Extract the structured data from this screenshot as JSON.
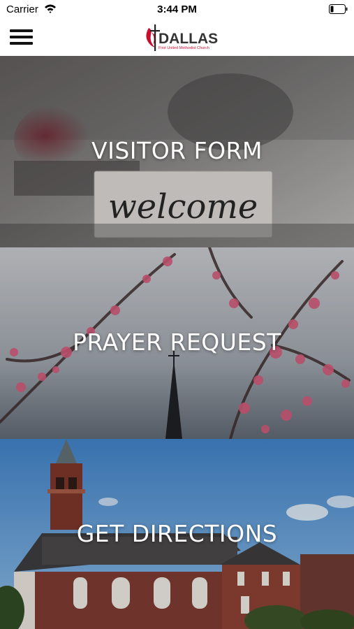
{
  "status_bar": {
    "carrier": "Carrier",
    "time": "3:44 PM",
    "wifi_icon": "wifi-icon",
    "battery_icon": "battery-icon"
  },
  "header": {
    "menu_icon": "hamburger-menu-icon",
    "logo": {
      "wordmark": "DALLAS",
      "subtitle": "First United Methodist Church",
      "colors": {
        "flame": "#c8102e",
        "cross": "#222222"
      }
    }
  },
  "tiles": [
    {
      "label": "VISITOR FORM",
      "image": "welcome-sign-photo"
    },
    {
      "label": "PRAYER REQUEST",
      "image": "blossom-branches-steeple-photo"
    },
    {
      "label": "GET DIRECTIONS",
      "image": "church-building-photo"
    }
  ]
}
